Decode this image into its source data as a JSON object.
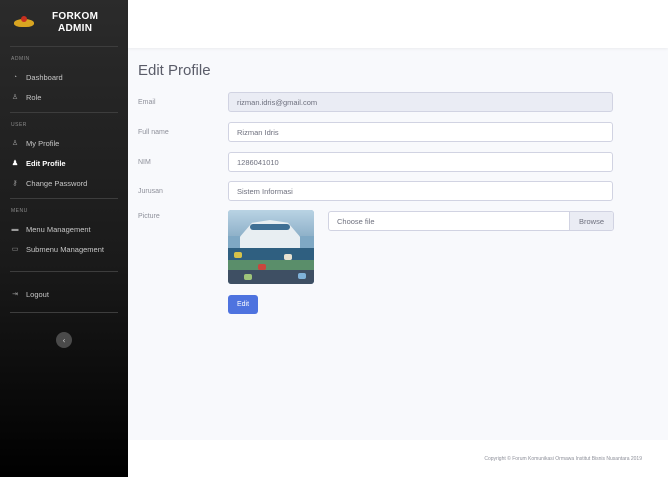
{
  "brand": {
    "line1": "FORKOM",
    "line2": "ADMIN"
  },
  "sidebar": {
    "sections": [
      {
        "heading": "ADMIN",
        "items": [
          {
            "label": "Dashboard",
            "icon": "gauge-icon"
          },
          {
            "label": "Role",
            "icon": "user-icon"
          }
        ]
      },
      {
        "heading": "USER",
        "items": [
          {
            "label": "My Profile",
            "icon": "user-icon"
          },
          {
            "label": "Edit Profile",
            "icon": "user-edit-icon",
            "active": true
          },
          {
            "label": "Change Password",
            "icon": "key-icon"
          }
        ]
      },
      {
        "heading": "MENU",
        "items": [
          {
            "label": "Menu Management",
            "icon": "folder-icon"
          },
          {
            "label": "Submenu Management",
            "icon": "folder-open-icon"
          }
        ]
      }
    ],
    "logout": "Logout",
    "toggle_icon": "chevron-left-icon"
  },
  "page": {
    "title": "Edit Profile"
  },
  "form": {
    "email": {
      "label": "Email",
      "value": "rizman.idris@gmail.com"
    },
    "fullname": {
      "label": "Full name",
      "value": "Rizman Idris"
    },
    "nim": {
      "label": "NIM",
      "value": "1286041010"
    },
    "jurusan": {
      "label": "Jurusan",
      "value": "Sistem Informasi"
    },
    "picture": {
      "label": "Picture",
      "file_placeholder": "Choose file",
      "browse_label": "Browse"
    },
    "submit_label": "Edit"
  },
  "footer": {
    "text": "Copyright © Forum Komunikasi Ormawa Institut Bisnis Nusantara 2019"
  },
  "colors": {
    "primary": "#4e73df",
    "sidebar_dark": "#1a1a1a"
  }
}
